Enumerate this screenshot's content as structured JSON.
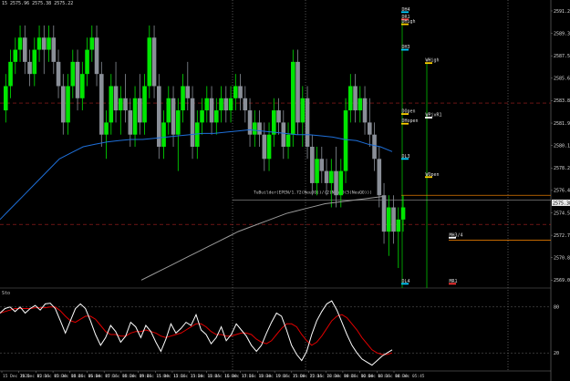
{
  "header": {
    "ohlc": "15 2575.96 2575.38 2575.22"
  },
  "colors": {
    "bull": "#00e600",
    "bear": "#8a8f98",
    "ma_fast": "#1e6fd9",
    "ma_slow": "#9a9a9a",
    "stoch_main": "#ffffff",
    "stoch_signal": "#e00000",
    "grid": "#555555",
    "red_dash": "#aa2222",
    "orange": "#e07800",
    "green": "#00c000"
  },
  "price_axis": {
    "labels": [
      "2591.20",
      "2589.35",
      "2587.50",
      "2585.65",
      "2583.80",
      "2581.95",
      "2580.10",
      "2578.25",
      "2576.40",
      "2574.55",
      "2572.70",
      "2570.85",
      "2569.00"
    ],
    "last_price": "2575.38",
    "last_price_value": 2575.38,
    "price_range": [
      2568.5,
      2591.8
    ]
  },
  "stoch_axis": {
    "title": "Sto",
    "labels": [
      "80",
      "20"
    ]
  },
  "levels": [
    {
      "label": "DH4",
      "price": 2591.1,
      "color": "#00ccff"
    },
    {
      "label": "DR1",
      "price": 2590.5,
      "color": "#ff3333"
    },
    {
      "label": "DHigh",
      "price": 2590.1,
      "color": "#ffd000"
    },
    {
      "label": "DH3",
      "price": 2588.0,
      "color": "#00ccff"
    },
    {
      "label": "WHigh",
      "price": 2586.9,
      "color": "#ffd000"
    },
    {
      "label": "DOpen",
      "price": 2582.7,
      "color": "#ffd000"
    },
    {
      "label": "WPivR1",
      "price": 2582.4,
      "color": "#ffffff"
    },
    {
      "label": "DHopen",
      "price": 2581.9,
      "color": "#ffd000"
    },
    {
      "label": "DL3",
      "price": 2579.0,
      "color": "#00ccff"
    },
    {
      "label": "WOpen",
      "price": 2577.5,
      "color": "#ffd000"
    },
    {
      "label": "MH3/4",
      "price": 2572.5,
      "color": "#ffffff"
    },
    {
      "label": "DL4",
      "price": 2568.7,
      "color": "#00ccff"
    },
    {
      "label": "MR1",
      "price": 2568.7,
      "color": "#ff3333"
    }
  ],
  "trendline_label": "TuBuilder(EPEN/1.72(NeuDO))/(2(NeuT0(5(NeuQO)))",
  "x_axis": {
    "labels": [
      "15 Dec 2021",
      "15 Dec 02:15",
      "15 Dec 03:30",
      "15 Dec 04:45",
      "15 Dec 06:00",
      "15 Dec 07:15",
      "15 Dec 08:30",
      "15 Dec 09:45",
      "15 Dec 11:00",
      "15 Dec 12:15",
      "15 Dec 13:30",
      "15 Dec 14:45",
      "15 Dec 16:00",
      "15 Dec 17:15",
      "15 Dec 18:30",
      "15 Dec 19:45",
      "15 Dec 21:00",
      "15 Dec 22:15",
      "15 Dec 23:30",
      "16 Dec 00:45",
      "16 Dec 02:00",
      "16 Dec 03:15",
      "16 Dec 04:30",
      "16 Dec 05:45"
    ]
  },
  "chart_data": {
    "type": "candlestick",
    "candles": [
      [
        2583,
        2586,
        2582,
        2585
      ],
      [
        2585,
        2588,
        2584,
        2587
      ],
      [
        2587,
        2589,
        2586,
        2588
      ],
      [
        2588,
        2590,
        2587,
        2589
      ],
      [
        2589,
        2590,
        2586,
        2587
      ],
      [
        2587,
        2588,
        2585,
        2586
      ],
      [
        2586,
        2589,
        2585,
        2588
      ],
      [
        2588,
        2590,
        2587,
        2589
      ],
      [
        2589,
        2590,
        2586,
        2588
      ],
      [
        2588,
        2590,
        2587,
        2589
      ],
      [
        2589,
        2590,
        2586,
        2587
      ],
      [
        2587,
        2588,
        2584,
        2585
      ],
      [
        2585,
        2586,
        2581,
        2582
      ],
      [
        2582,
        2586,
        2581,
        2585
      ],
      [
        2585,
        2588,
        2584,
        2587
      ],
      [
        2587,
        2588,
        2583,
        2584
      ],
      [
        2584,
        2587,
        2583,
        2586
      ],
      [
        2586,
        2589,
        2585,
        2588
      ],
      [
        2588,
        2590,
        2587,
        2589
      ],
      [
        2589,
        2590,
        2585,
        2586
      ],
      [
        2586,
        2587,
        2580,
        2581
      ],
      [
        2581,
        2583,
        2579,
        2582
      ],
      [
        2582,
        2586,
        2581,
        2585
      ],
      [
        2585,
        2587,
        2582,
        2583
      ],
      [
        2583,
        2585,
        2581,
        2584
      ],
      [
        2584,
        2586,
        2582,
        2583
      ],
      [
        2583,
        2584,
        2580,
        2581
      ],
      [
        2581,
        2585,
        2580,
        2584
      ],
      [
        2584,
        2586,
        2581,
        2582
      ],
      [
        2582,
        2586,
        2581,
        2585
      ],
      [
        2585,
        2590,
        2584,
        2589
      ],
      [
        2589,
        2590,
        2584,
        2585
      ],
      [
        2585,
        2586,
        2579,
        2580
      ],
      [
        2580,
        2583,
        2579,
        2582
      ],
      [
        2582,
        2585,
        2581,
        2584
      ],
      [
        2584,
        2585,
        2580,
        2581
      ],
      [
        2581,
        2584,
        2578,
        2583
      ],
      [
        2583,
        2586,
        2582,
        2585
      ],
      [
        2585,
        2587,
        2583,
        2584
      ],
      [
        2584,
        2585,
        2579,
        2580
      ],
      [
        2580,
        2583,
        2579,
        2582
      ],
      [
        2582,
        2584,
        2581,
        2583
      ],
      [
        2583,
        2585,
        2582,
        2584
      ],
      [
        2584,
        2585,
        2581,
        2582
      ],
      [
        2582,
        2584,
        2581,
        2583
      ],
      [
        2583,
        2585,
        2582,
        2584
      ],
      [
        2584,
        2585,
        2582,
        2583
      ],
      [
        2583,
        2585,
        2582,
        2584
      ],
      [
        2584,
        2586,
        2583,
        2585
      ],
      [
        2585,
        2586,
        2583,
        2584
      ],
      [
        2584,
        2585,
        2582,
        2583
      ],
      [
        2583,
        2584,
        2580,
        2581
      ],
      [
        2581,
        2583,
        2580,
        2582
      ],
      [
        2582,
        2583,
        2580,
        2581
      ],
      [
        2581,
        2582,
        2578,
        2579
      ],
      [
        2579,
        2582,
        2578,
        2581
      ],
      [
        2581,
        2584,
        2580,
        2583
      ],
      [
        2583,
        2584,
        2581,
        2582
      ],
      [
        2582,
        2583,
        2579,
        2580
      ],
      [
        2580,
        2582,
        2579,
        2581
      ],
      [
        2581,
        2588,
        2580,
        2587
      ],
      [
        2587,
        2588,
        2581,
        2582
      ],
      [
        2582,
        2585,
        2580,
        2584
      ],
      [
        2584,
        2585,
        2579,
        2580
      ],
      [
        2580,
        2581,
        2576,
        2577
      ],
      [
        2577,
        2580,
        2576,
        2579
      ],
      [
        2579,
        2580,
        2577,
        2578
      ],
      [
        2578,
        2579,
        2576,
        2577
      ],
      [
        2577,
        2579,
        2575,
        2578
      ],
      [
        2578,
        2580,
        2575,
        2576
      ],
      [
        2576,
        2579,
        2575,
        2578
      ],
      [
        2578,
        2584,
        2577,
        2583
      ],
      [
        2583,
        2586,
        2582,
        2585
      ],
      [
        2585,
        2586,
        2582,
        2583
      ],
      [
        2583,
        2585,
        2582,
        2584
      ],
      [
        2584,
        2585,
        2581,
        2582
      ],
      [
        2582,
        2584,
        2580,
        2581
      ],
      [
        2581,
        2582,
        2578,
        2579
      ],
      [
        2579,
        2580,
        2575,
        2576
      ],
      [
        2576,
        2577,
        2572,
        2573
      ],
      [
        2573,
        2576,
        2571,
        2575
      ],
      [
        2575,
        2576,
        2572,
        2573
      ],
      [
        2573,
        2575,
        2570,
        2574
      ],
      [
        2574,
        2576,
        2573,
        2575
      ]
    ],
    "ma_fast": [
      2574,
      2575,
      2576,
      2577,
      2578,
      2579,
      2579.5,
      2580,
      2580.2,
      2580.4,
      2580.5,
      2580.6,
      2580.6,
      2580.7,
      2580.8,
      2580.9,
      2581,
      2581.1,
      2581.1,
      2581.2,
      2581.3,
      2581.4,
      2581.3,
      2581.2,
      2581.1,
      2581,
      2581,
      2580.9,
      2580.8,
      2580.6,
      2580.5,
      2580.2,
      2580,
      2579.6
    ],
    "ma_slow": [
      2569,
      2569.4,
      2569.8,
      2570.2,
      2570.6,
      2571,
      2571.4,
      2571.8,
      2572.2,
      2572.6,
      2573,
      2573.3,
      2573.6,
      2573.9,
      2574.2,
      2574.5,
      2574.7,
      2574.9,
      2575.1,
      2575.3,
      2575.4,
      2575.5,
      2575.6,
      2575.7,
      2575.8,
      2575.9
    ],
    "stoch_main": [
      72,
      78,
      80,
      74,
      80,
      72,
      78,
      82,
      76,
      84,
      85,
      78,
      62,
      46,
      62,
      78,
      84,
      78,
      62,
      44,
      30,
      40,
      56,
      48,
      34,
      42,
      60,
      54,
      40,
      56,
      48,
      34,
      22,
      38,
      58,
      46,
      52,
      60,
      56,
      70,
      50,
      44,
      32,
      40,
      54,
      36,
      44,
      58,
      50,
      42,
      30,
      22,
      30,
      46,
      60,
      72,
      68,
      50,
      30,
      18,
      10,
      22,
      44,
      62,
      74,
      84,
      88,
      76,
      60,
      44,
      30,
      20,
      12,
      8,
      4,
      10,
      16,
      20,
      24
    ],
    "stoch_signal": [
      72,
      74,
      76,
      78,
      78,
      78,
      78,
      79,
      79,
      79,
      80,
      80,
      75,
      68,
      62,
      60,
      64,
      68,
      68,
      64,
      56,
      48,
      44,
      44,
      42,
      42,
      46,
      48,
      48,
      50,
      48,
      46,
      42,
      40,
      42,
      44,
      46,
      50,
      54,
      58,
      58,
      54,
      48,
      44,
      44,
      42,
      42,
      44,
      46,
      46,
      44,
      38,
      34,
      32,
      36,
      44,
      52,
      58,
      58,
      54,
      44,
      36,
      30,
      34,
      42,
      52,
      62,
      68,
      70,
      66,
      58,
      50,
      40,
      32,
      24,
      20,
      18,
      18,
      20
    ],
    "stoch_range": [
      0,
      100
    ],
    "stoch_levels": [
      80,
      20
    ]
  }
}
